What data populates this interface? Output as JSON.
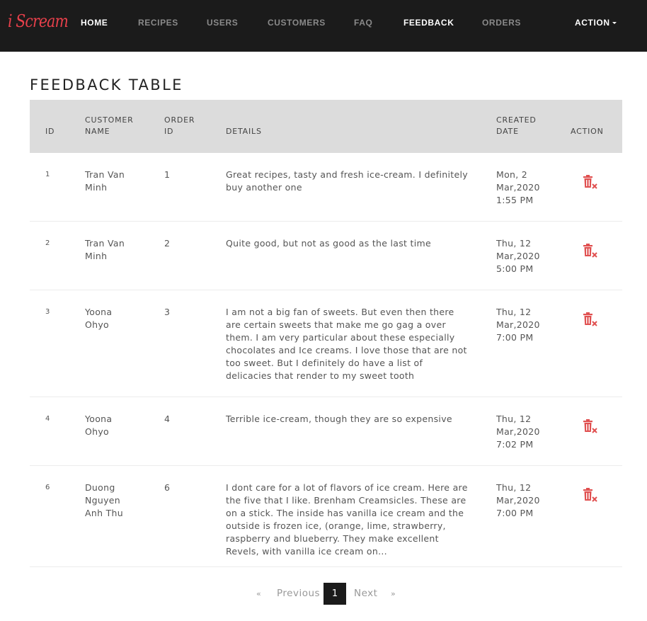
{
  "brand": "i Scream",
  "nav": {
    "items": [
      {
        "label": "HOME"
      },
      {
        "label": "RECIPES"
      },
      {
        "label": "USERS"
      },
      {
        "label": "CUSTOMERS"
      },
      {
        "label": "FAQ"
      },
      {
        "label": "FEEDBACK"
      },
      {
        "label": "ORDERS"
      }
    ],
    "action_label": "ACTION",
    "active": "FEEDBACK"
  },
  "page_title": "FEEDBACK TABLE",
  "table": {
    "headers": {
      "id": "ID",
      "customer_name": "CUSTOMER NAME",
      "order_id": "ORDER ID",
      "details": "DETAILS",
      "created_date": "CREATED DATE",
      "action": "ACTION"
    },
    "rows": [
      {
        "id": "1",
        "customer": "Tran Van Minh",
        "order_id": "1",
        "details": "Great recipes, tasty and fresh ice-cream. I definitely buy another one",
        "created": "Mon, 2 Mar,2020 1:55 PM"
      },
      {
        "id": "2",
        "customer": "Tran Van Minh",
        "order_id": "2",
        "details": "Quite good, but not as good as the last time",
        "created": "Thu, 12 Mar,2020 5:00 PM"
      },
      {
        "id": "3",
        "customer": "Yoona Ohyo",
        "order_id": "3",
        "details": "I am not a big fan of sweets. But even then there are certain sweets that make me go gag a over them. I am very particular about these especially chocolates and Ice creams. I love those that are not too sweet. But I definitely do have a list of delicacies that render to my sweet tooth",
        "created": "Thu, 12 Mar,2020 7:00 PM"
      },
      {
        "id": "4",
        "customer": "Yoona Ohyo",
        "order_id": "4",
        "details": "Terrible ice-cream, though they are so expensive",
        "created": "Thu, 12 Mar,2020 7:02 PM"
      },
      {
        "id": "6",
        "customer": "Duong Nguyen Anh Thu",
        "order_id": "6",
        "details": "I dont care for a lot of flavors of ice cream. Here are the five that I like. Brenham Creamsicles. These are on a stick. The inside has vanilla ice cream and the outside is frozen ice, (orange, lime, strawberry, raspberry and blueberry. They make excellent Revels, with vanilla ice cream on...",
        "created": "Thu, 12 Mar,2020 7:00 PM"
      }
    ],
    "delete_icon": "trash-delete-icon"
  },
  "pagination": {
    "first": "«",
    "previous": "Previous",
    "current": "1",
    "next": "Next",
    "last": "»"
  },
  "colors": {
    "nav_bg": "#1b1b1b",
    "brand": "#e8404b",
    "header_bg": "#dcdcdc",
    "delete_icon": "#e05050"
  }
}
